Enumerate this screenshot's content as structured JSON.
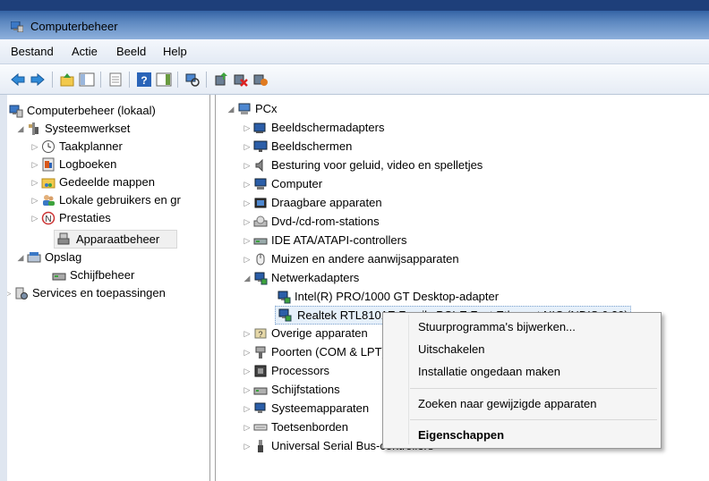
{
  "window": {
    "title": "Computerbeheer"
  },
  "menu": [
    "Bestand",
    "Actie",
    "Beeld",
    "Help"
  ],
  "toolbar_icons": [
    "back-arrow-icon",
    "forward-arrow-icon",
    "up-folder-icon",
    "show-hide-tree-icon",
    "properties-icon",
    "help-icon",
    "show-hide-action-pane-icon",
    "scan-hardware-icon",
    "update-driver-icon",
    "disable-device-icon",
    "uninstall-device-icon"
  ],
  "left_tree": [
    {
      "label": "Computerbeheer (lokaal)",
      "icon": "computer-management-icon"
    },
    {
      "label": "Systeemwerkset",
      "icon": "system-tools-icon"
    },
    {
      "label": "Taakplanner",
      "icon": "clock-icon"
    },
    {
      "label": "Logboeken",
      "icon": "event-viewer-icon"
    },
    {
      "label": "Gedeelde mappen",
      "icon": "shared-folder-icon"
    },
    {
      "label": "Lokale gebruikers en gr",
      "icon": "users-icon"
    },
    {
      "label": "Prestaties",
      "icon": "performance-icon"
    },
    {
      "label": "Apparaatbeheer",
      "icon": "device-manager-icon"
    },
    {
      "label": "Opslag",
      "icon": "storage-icon"
    },
    {
      "label": "Schijfbeheer",
      "icon": "disk-management-icon"
    },
    {
      "label": "Services en toepassingen",
      "icon": "services-icon"
    }
  ],
  "device_tree": {
    "root": "PCx",
    "items": [
      {
        "label": "Beeldschermadapters",
        "icon": "display-adapter-icon"
      },
      {
        "label": "Beeldschermen",
        "icon": "monitor-icon"
      },
      {
        "label": "Besturing voor geluid, video en spelletjes",
        "icon": "speaker-icon"
      },
      {
        "label": "Computer",
        "icon": "computer-icon"
      },
      {
        "label": "Draagbare apparaten",
        "icon": "portable-device-icon"
      },
      {
        "label": "Dvd-/cd-rom-stations",
        "icon": "cdrom-icon"
      },
      {
        "label": "IDE ATA/ATAPI-controllers",
        "icon": "ide-controller-icon"
      },
      {
        "label": "Muizen en andere aanwijsapparaten",
        "icon": "mouse-icon"
      },
      {
        "label": "Netwerkadapters",
        "icon": "network-adapter-icon"
      },
      {
        "label": "Intel(R) PRO/1000 GT Desktop-adapter",
        "icon": "network-adapter-icon"
      },
      {
        "label": "Realtek RTL8101E Family PCI-E Fast Ethernet NIC (NDIS 6.20)",
        "icon": "network-adapter-icon"
      },
      {
        "label": "Overige apparaten",
        "icon": "unknown-device-icon"
      },
      {
        "label": "Poorten (COM & LPT)",
        "icon": "port-icon"
      },
      {
        "label": "Processors",
        "icon": "processor-icon"
      },
      {
        "label": "Schijfstations",
        "icon": "disk-drive-icon"
      },
      {
        "label": "Systeemapparaten",
        "icon": "system-device-icon"
      },
      {
        "label": "Toetsenborden",
        "icon": "keyboard-icon"
      },
      {
        "label": "Universal Serial Bus-controllers",
        "icon": "usb-icon"
      }
    ]
  },
  "context_menu": [
    "Stuurprogramma's bijwerken...",
    "Uitschakelen",
    "Installatie ongedaan maken",
    "Zoeken naar gewijzigde apparaten",
    "Eigenschappen"
  ]
}
